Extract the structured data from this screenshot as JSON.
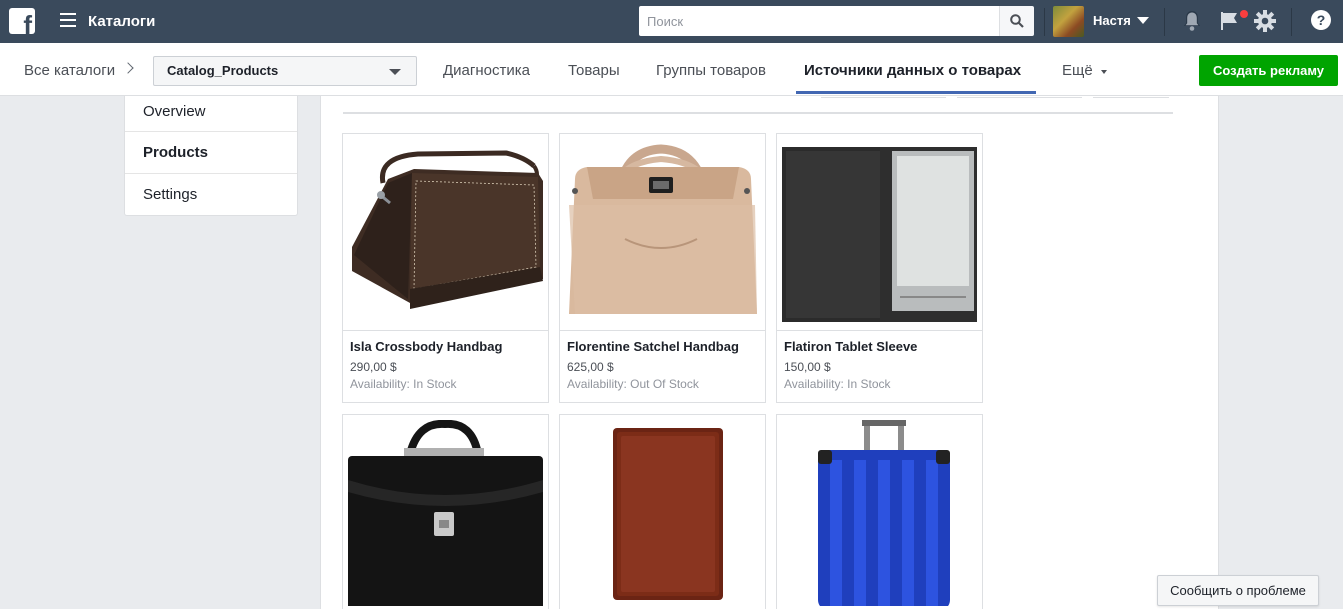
{
  "topbar": {
    "logo_letter": "f",
    "app_title": "Каталоги",
    "search_placeholder": "Поиск",
    "user_name": "Настя",
    "help_label": "?"
  },
  "subnav": {
    "crumb": "Все каталоги",
    "catalog_selected": "Catalog_Products",
    "tabs": [
      "Диагностика",
      "Товары",
      "Группы товаров",
      "Источники данных о товарах",
      "Ещё"
    ],
    "active_tab": "Источники данных о товарах",
    "create_ad_label": "Создать рекламу"
  },
  "leftnav": {
    "items": [
      "Overview",
      "Products",
      "Settings"
    ],
    "active": "Products"
  },
  "products": [
    {
      "name": "Isla Crossbody Handbag",
      "price": "290,00 $",
      "availability": "Availability: In Stock"
    },
    {
      "name": "Florentine Satchel Handbag",
      "price": "625,00 $",
      "availability": "Availability: Out Of Stock"
    },
    {
      "name": "Flatiron Tablet Sleeve",
      "price": "150,00 $",
      "availability": "Availability: In Stock"
    },
    {
      "name": "",
      "price": "",
      "availability": ""
    },
    {
      "name": "",
      "price": "",
      "availability": ""
    },
    {
      "name": "",
      "price": "",
      "availability": ""
    }
  ],
  "report_label": "Сообщить о проблеме",
  "colors": {
    "topbar": "#3a4a5c",
    "accent_tab": "#4267b2",
    "create_button": "#00a400",
    "notification": "#fa3e3e"
  }
}
